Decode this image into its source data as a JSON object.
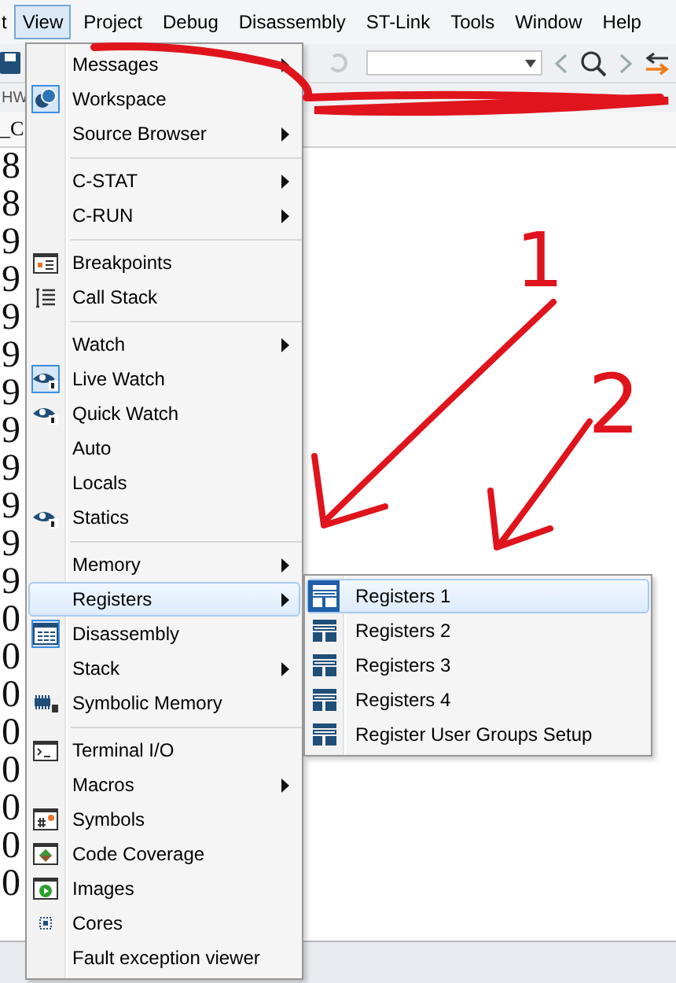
{
  "menubar": [
    {
      "label": "t",
      "selected": false
    },
    {
      "label": "View",
      "selected": true
    },
    {
      "label": "Project",
      "selected": false
    },
    {
      "label": "Debug",
      "selected": false
    },
    {
      "label": "Disassembly",
      "selected": false
    },
    {
      "label": "ST-Link",
      "selected": false
    },
    {
      "label": "Tools",
      "selected": false
    },
    {
      "label": "Window",
      "selected": false
    },
    {
      "label": "Help",
      "selected": false
    }
  ],
  "panel_strip": {
    "label": "HW"
  },
  "editor_tab": {
    "label": "_C"
  },
  "gutter": [
    "8",
    "8",
    "9",
    "9",
    "9",
    "9",
    "9",
    "9",
    "9",
    "9",
    "9",
    "9",
    "0",
    "0",
    "0",
    "0",
    "0",
    "0",
    "0",
    "0"
  ],
  "view_menu": [
    {
      "kind": "item",
      "label": "Messages",
      "submenu": true,
      "checked": false,
      "selected": false
    },
    {
      "kind": "item",
      "label": "Workspace",
      "submenu": false,
      "checked": true,
      "selected": false
    },
    {
      "kind": "item",
      "label": "Source Browser",
      "submenu": true,
      "checked": false,
      "selected": false
    },
    {
      "kind": "separator"
    },
    {
      "kind": "item",
      "label": "C-STAT",
      "submenu": true,
      "checked": false,
      "selected": false
    },
    {
      "kind": "item",
      "label": "C-RUN",
      "submenu": true,
      "checked": false,
      "selected": false
    },
    {
      "kind": "separator"
    },
    {
      "kind": "item",
      "label": "Breakpoints",
      "submenu": false,
      "checked": false,
      "selected": false
    },
    {
      "kind": "item",
      "label": "Call Stack",
      "submenu": false,
      "checked": false,
      "selected": false
    },
    {
      "kind": "separator"
    },
    {
      "kind": "item",
      "label": "Watch",
      "submenu": true,
      "checked": false,
      "selected": false
    },
    {
      "kind": "item",
      "label": "Live Watch",
      "submenu": false,
      "checked": true,
      "selected": false
    },
    {
      "kind": "item",
      "label": "Quick Watch",
      "submenu": false,
      "checked": false,
      "selected": false
    },
    {
      "kind": "item",
      "label": "Auto",
      "submenu": false,
      "checked": false,
      "selected": false
    },
    {
      "kind": "item",
      "label": "Locals",
      "submenu": false,
      "checked": false,
      "selected": false
    },
    {
      "kind": "item",
      "label": "Statics",
      "submenu": false,
      "checked": false,
      "selected": false
    },
    {
      "kind": "separator"
    },
    {
      "kind": "item",
      "label": "Memory",
      "submenu": true,
      "checked": false,
      "selected": false
    },
    {
      "kind": "item",
      "label": "Registers",
      "submenu": true,
      "checked": false,
      "selected": true
    },
    {
      "kind": "item",
      "label": "Disassembly",
      "submenu": false,
      "checked": true,
      "selected": false
    },
    {
      "kind": "item",
      "label": "Stack",
      "submenu": true,
      "checked": false,
      "selected": false
    },
    {
      "kind": "item",
      "label": "Symbolic Memory",
      "submenu": false,
      "checked": false,
      "selected": false
    },
    {
      "kind": "separator"
    },
    {
      "kind": "item",
      "label": "Terminal I/O",
      "submenu": false,
      "checked": false,
      "selected": false
    },
    {
      "kind": "item",
      "label": "Macros",
      "submenu": true,
      "checked": false,
      "selected": false
    },
    {
      "kind": "item",
      "label": "Symbols",
      "submenu": false,
      "checked": false,
      "selected": false
    },
    {
      "kind": "item",
      "label": "Code Coverage",
      "submenu": false,
      "checked": false,
      "selected": false
    },
    {
      "kind": "item",
      "label": "Images",
      "submenu": false,
      "checked": false,
      "selected": false
    },
    {
      "kind": "item",
      "label": "Cores",
      "submenu": false,
      "checked": false,
      "selected": false
    },
    {
      "kind": "item",
      "label": "Fault exception viewer",
      "submenu": false,
      "checked": false,
      "selected": false
    }
  ],
  "registers_submenu": [
    {
      "label": "Registers 1",
      "selected": true
    },
    {
      "label": "Registers 2",
      "selected": false
    },
    {
      "label": "Registers 3",
      "selected": false
    },
    {
      "label": "Registers 4",
      "selected": false
    },
    {
      "label": "Register User Groups Setup",
      "selected": false
    }
  ],
  "annotations": [
    {
      "label": "1"
    },
    {
      "label": "2"
    }
  ]
}
